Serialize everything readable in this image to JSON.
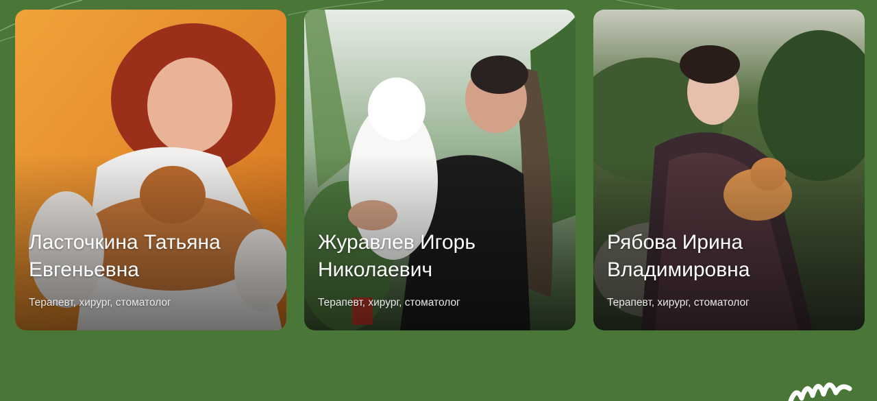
{
  "team": {
    "doctors": [
      {
        "name": "Ласточкина Татьяна Евгеньевна",
        "role": "Терапевт, хирург, стоматолог"
      },
      {
        "name": "Журавлев Игорь Николаевич",
        "role": "Терапевт, хирург, стоматолог"
      },
      {
        "name": "Рябова Ирина Владимировна",
        "role": "Терапевт, хирург, стоматолог"
      }
    ]
  },
  "colors": {
    "page_background": "#4a7638",
    "card_text": "#ffffff",
    "deco_line": "#a9c89a"
  },
  "icons": {
    "background_lines": "decorative-lines-icon",
    "brand_mark": "brand-scribble-icon"
  }
}
